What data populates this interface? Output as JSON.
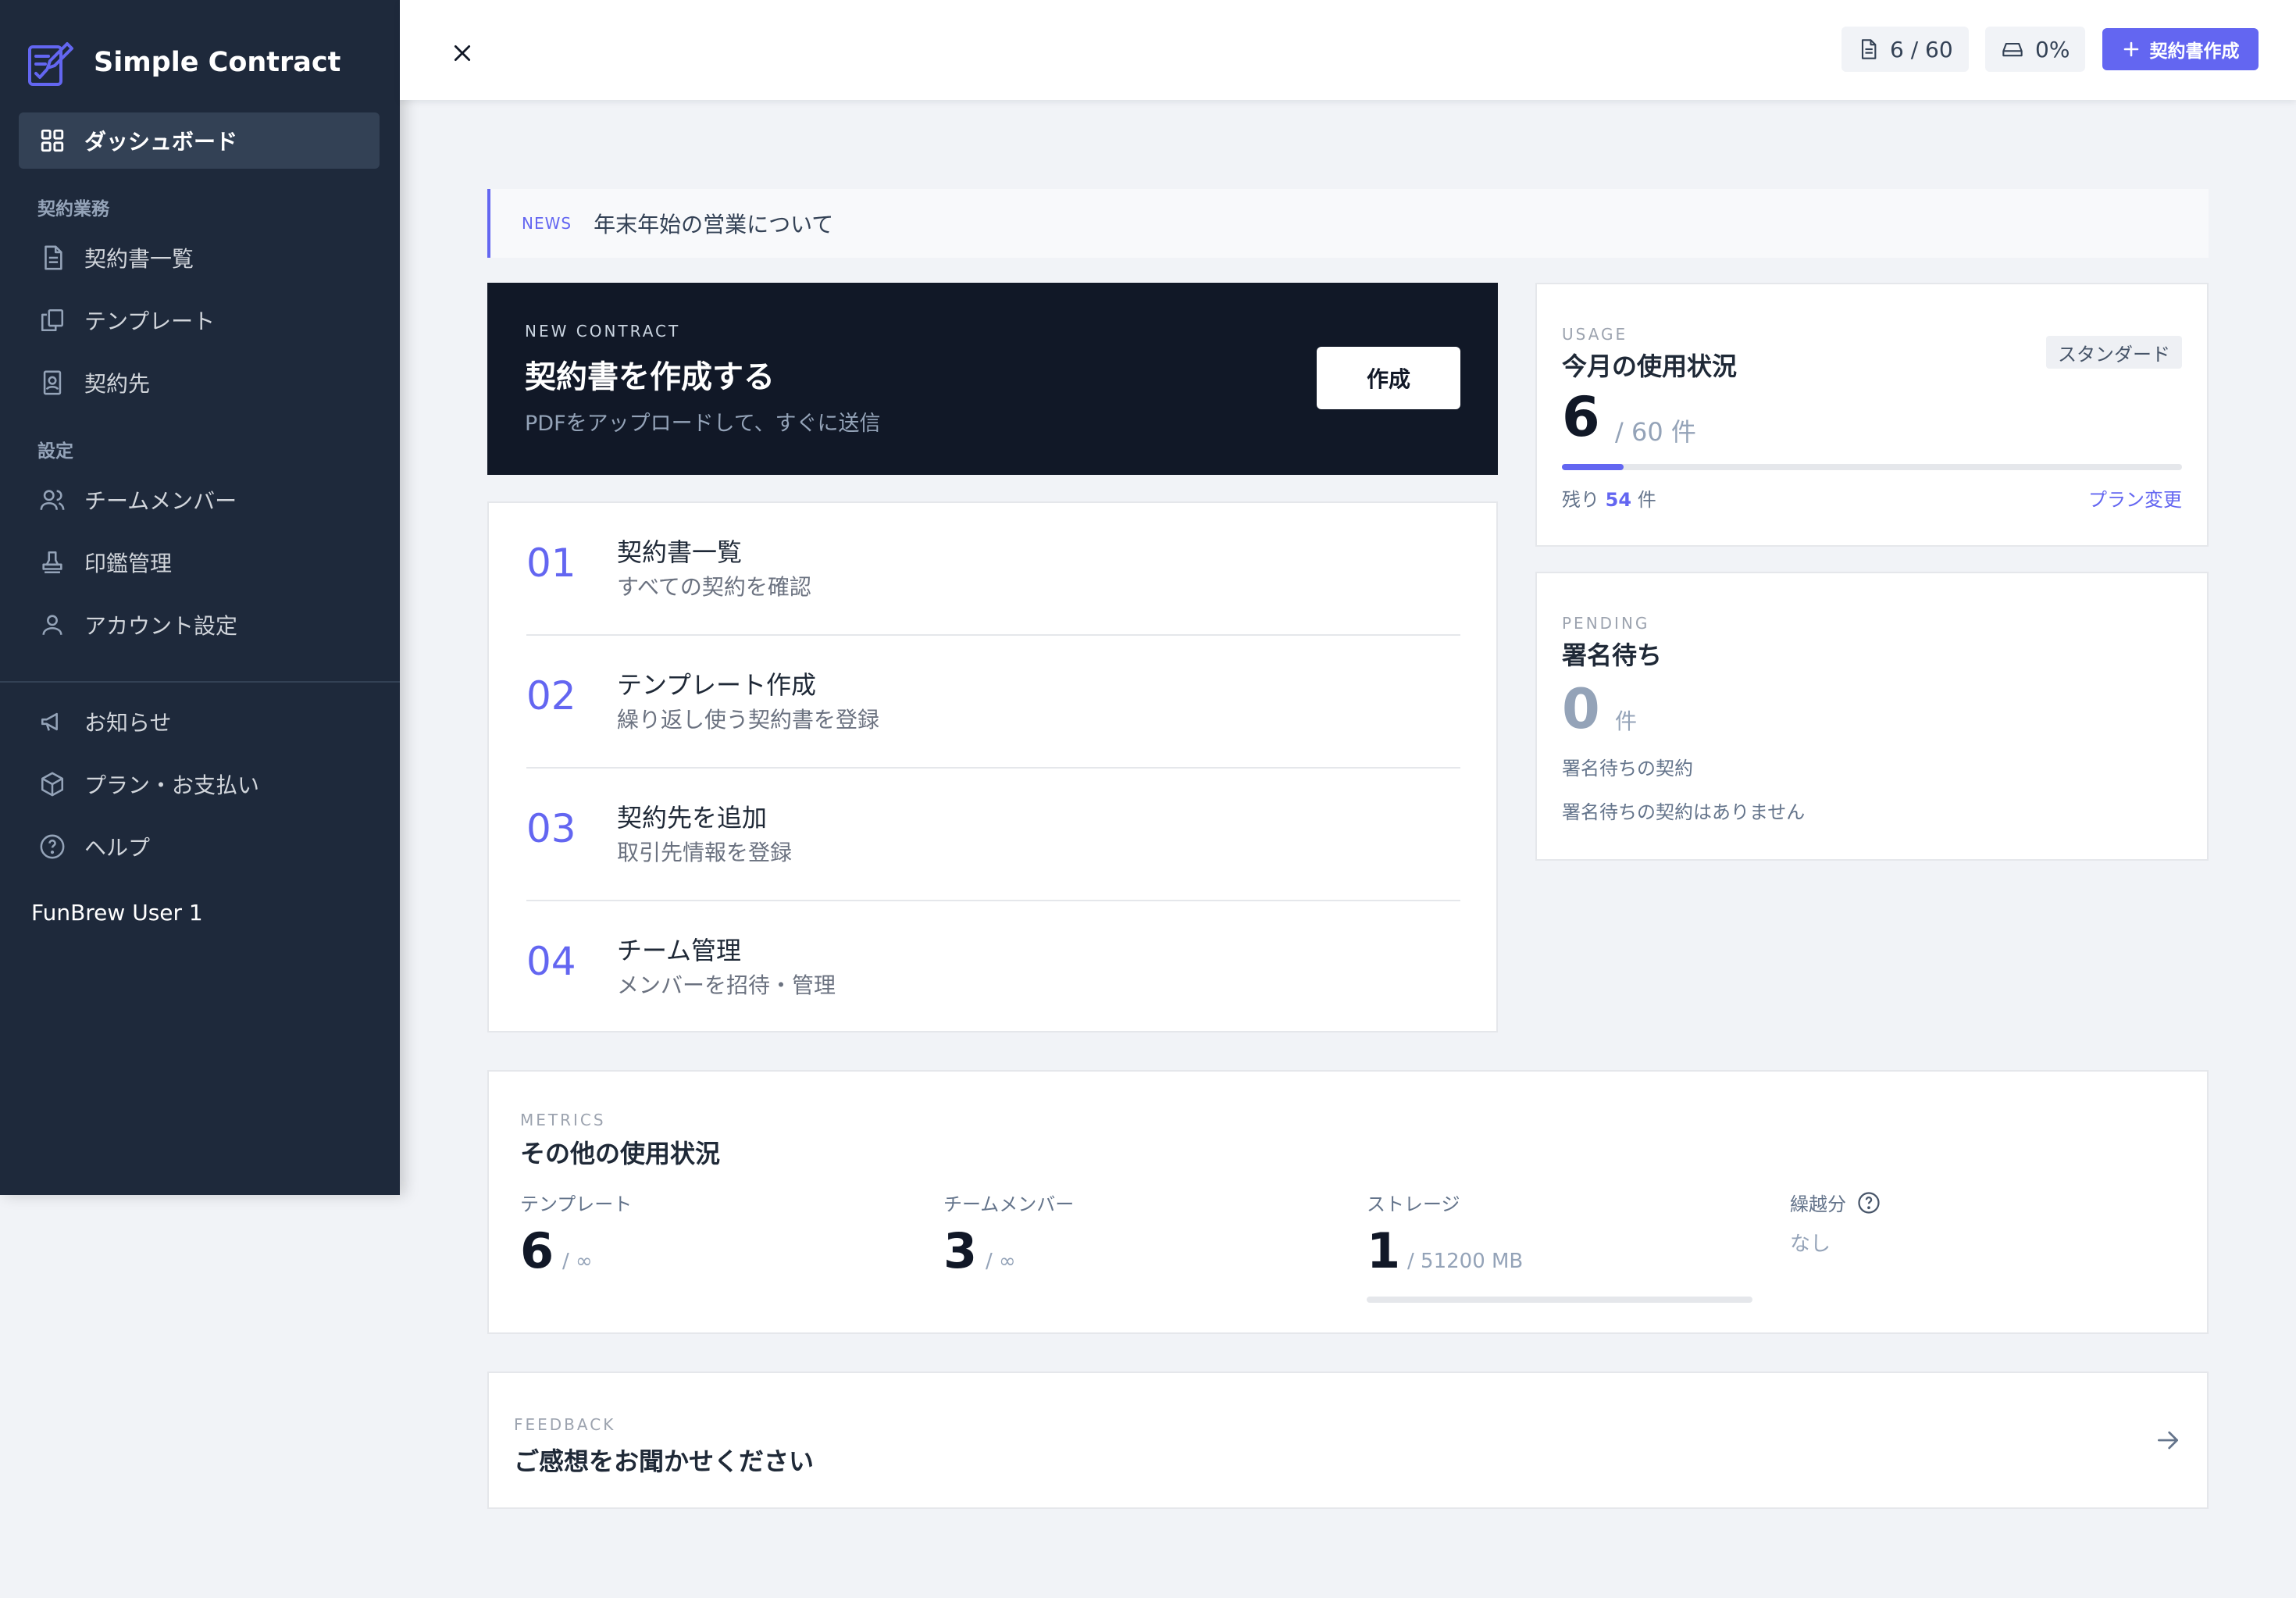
{
  "app": {
    "name": "Simple Contract",
    "accent_color": "#6366f1",
    "sidebar_color": "#1e293b"
  },
  "sidebar": {
    "items": [
      {
        "label": "ダッシュボード",
        "icon": "grid-icon",
        "active": true
      },
      {
        "label": "契約書一覧",
        "icon": "document-icon"
      },
      {
        "label": "テンプレート",
        "icon": "copy-icon"
      },
      {
        "label": "契約先",
        "icon": "contact-book-icon"
      },
      {
        "label": "チームメンバー",
        "icon": "users-icon"
      },
      {
        "label": "印鑑管理",
        "icon": "stamp-icon"
      },
      {
        "label": "アカウント設定",
        "icon": "user-icon"
      },
      {
        "label": "お知らせ",
        "icon": "megaphone-icon"
      },
      {
        "label": "プラン・お支払い",
        "icon": "box-icon"
      },
      {
        "label": "ヘルプ",
        "icon": "help-circle-icon"
      }
    ],
    "section_contracts": "契約業務",
    "section_settings": "設定",
    "user_name": "FunBrew User 1"
  },
  "header": {
    "doc_count": "6 / 60",
    "storage_percent": "0%",
    "create_button": "契約書作成"
  },
  "news": {
    "tag": "NEWS",
    "text": "年末年始の営業について"
  },
  "new_contract": {
    "overline": "NEW CONTRACT",
    "title": "契約書を作成する",
    "subtitle": "PDFをアップロードして、すぐに送信",
    "button": "作成"
  },
  "steps": [
    {
      "num": "01",
      "title": "契約書一覧",
      "desc": "すべての契約を確認"
    },
    {
      "num": "02",
      "title": "テンプレート作成",
      "desc": "繰り返し使う契約書を登録"
    },
    {
      "num": "03",
      "title": "契約先を追加",
      "desc": "取引先情報を登録"
    },
    {
      "num": "04",
      "title": "チーム管理",
      "desc": "メンバーを招待・管理"
    }
  ],
  "usage": {
    "overline": "USAGE",
    "title": "今月の使用状況",
    "plan": "スタンダード",
    "used": "6",
    "limit_text": "/ 60 件",
    "used_fraction": 0.1,
    "remaining_prefix": "残り",
    "remaining": "54",
    "remaining_suffix": "件",
    "change_plan": "プラン変更"
  },
  "pending": {
    "overline": "PENDING",
    "title": "署名待ち",
    "count": "0",
    "unit": "件",
    "label": "署名待ちの契約",
    "empty": "署名待ちの契約はありません"
  },
  "metrics": {
    "overline": "METRICS",
    "title": "その他の使用状況",
    "items": [
      {
        "label": "テンプレート",
        "value": "6",
        "limit": "/ ∞"
      },
      {
        "label": "チームメンバー",
        "value": "3",
        "limit": "/ ∞"
      },
      {
        "label": "ストレージ",
        "value": "1",
        "limit": "/ 51200 MB",
        "fraction": 0.0
      },
      {
        "label": "繰越分",
        "value": "なし"
      }
    ]
  },
  "feedback": {
    "overline": "FEEDBACK",
    "title": "ご感想をお聞かせください"
  }
}
